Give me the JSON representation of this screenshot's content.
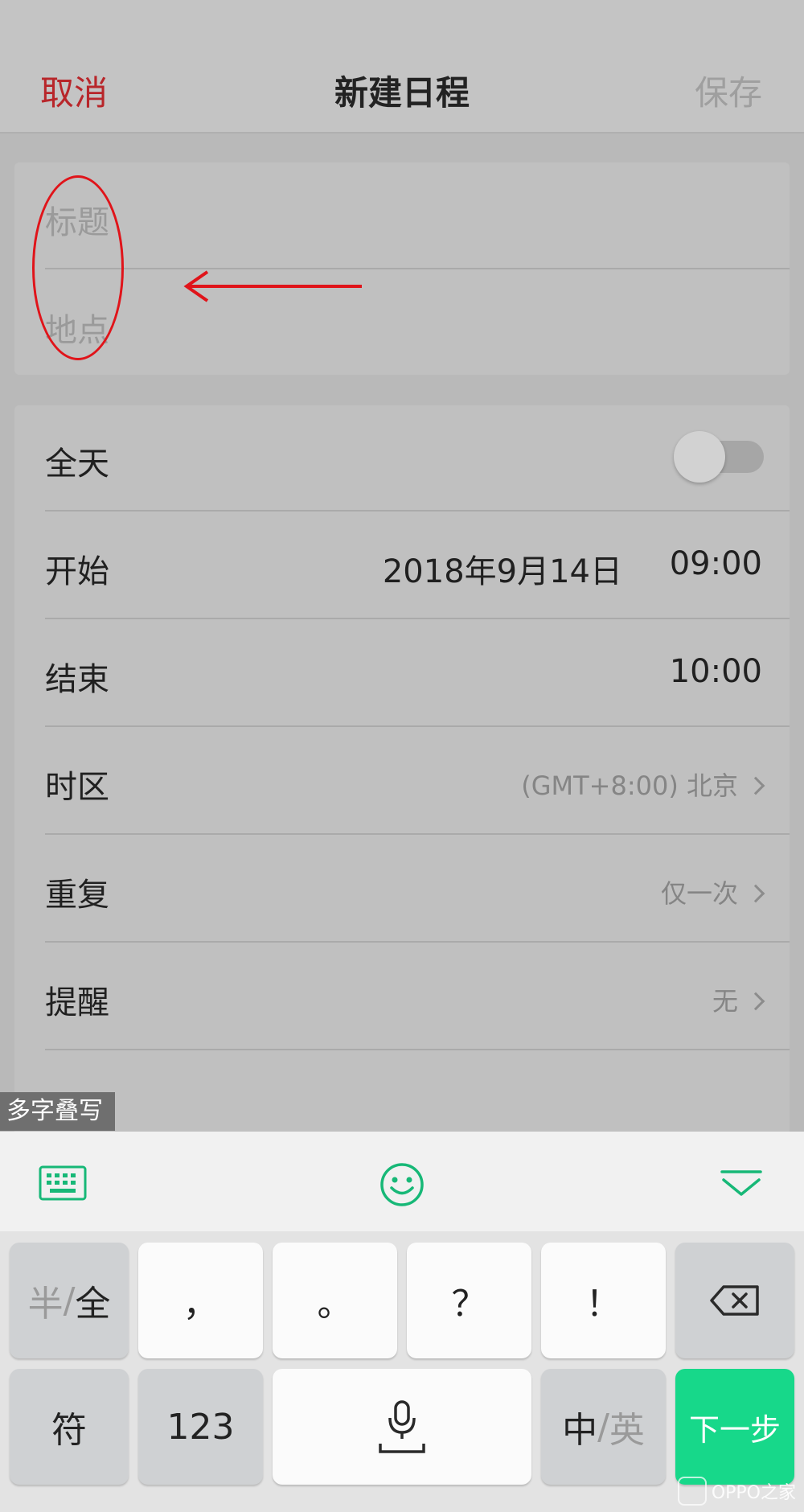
{
  "header": {
    "cancel": "取消",
    "title": "新建日程",
    "save": "保存"
  },
  "event": {
    "title_placeholder": "标题",
    "location_placeholder": "地点"
  },
  "settings": {
    "all_day": {
      "label": "全天",
      "enabled": false
    },
    "start": {
      "label": "开始",
      "date": "2018年9月14日",
      "time": "09:00"
    },
    "end": {
      "label": "结束",
      "time": "10:00"
    },
    "timezone": {
      "label": "时区",
      "value": "(GMT+8:00) 北京"
    },
    "repeat": {
      "label": "重复",
      "value": "仅一次"
    },
    "reminder": {
      "label": "提醒",
      "value": "无"
    }
  },
  "overlay": {
    "multi_char": "多字叠写"
  },
  "keyboard": {
    "row1": {
      "half_full_a": "半",
      "half_full_sep": "/",
      "half_full_b": "全",
      "comma": "，",
      "period": "。",
      "question": "？",
      "exclaim": "！"
    },
    "row2": {
      "symbols": "符",
      "numbers": "123",
      "lang_a": "中",
      "lang_sep": "/",
      "lang_b": "英",
      "next": "下一步"
    },
    "accent": "#17d88a"
  },
  "watermark": {
    "text": "OPPO之家"
  },
  "colors": {
    "cancel": "#b8262a",
    "annotation": "#e0141a"
  }
}
